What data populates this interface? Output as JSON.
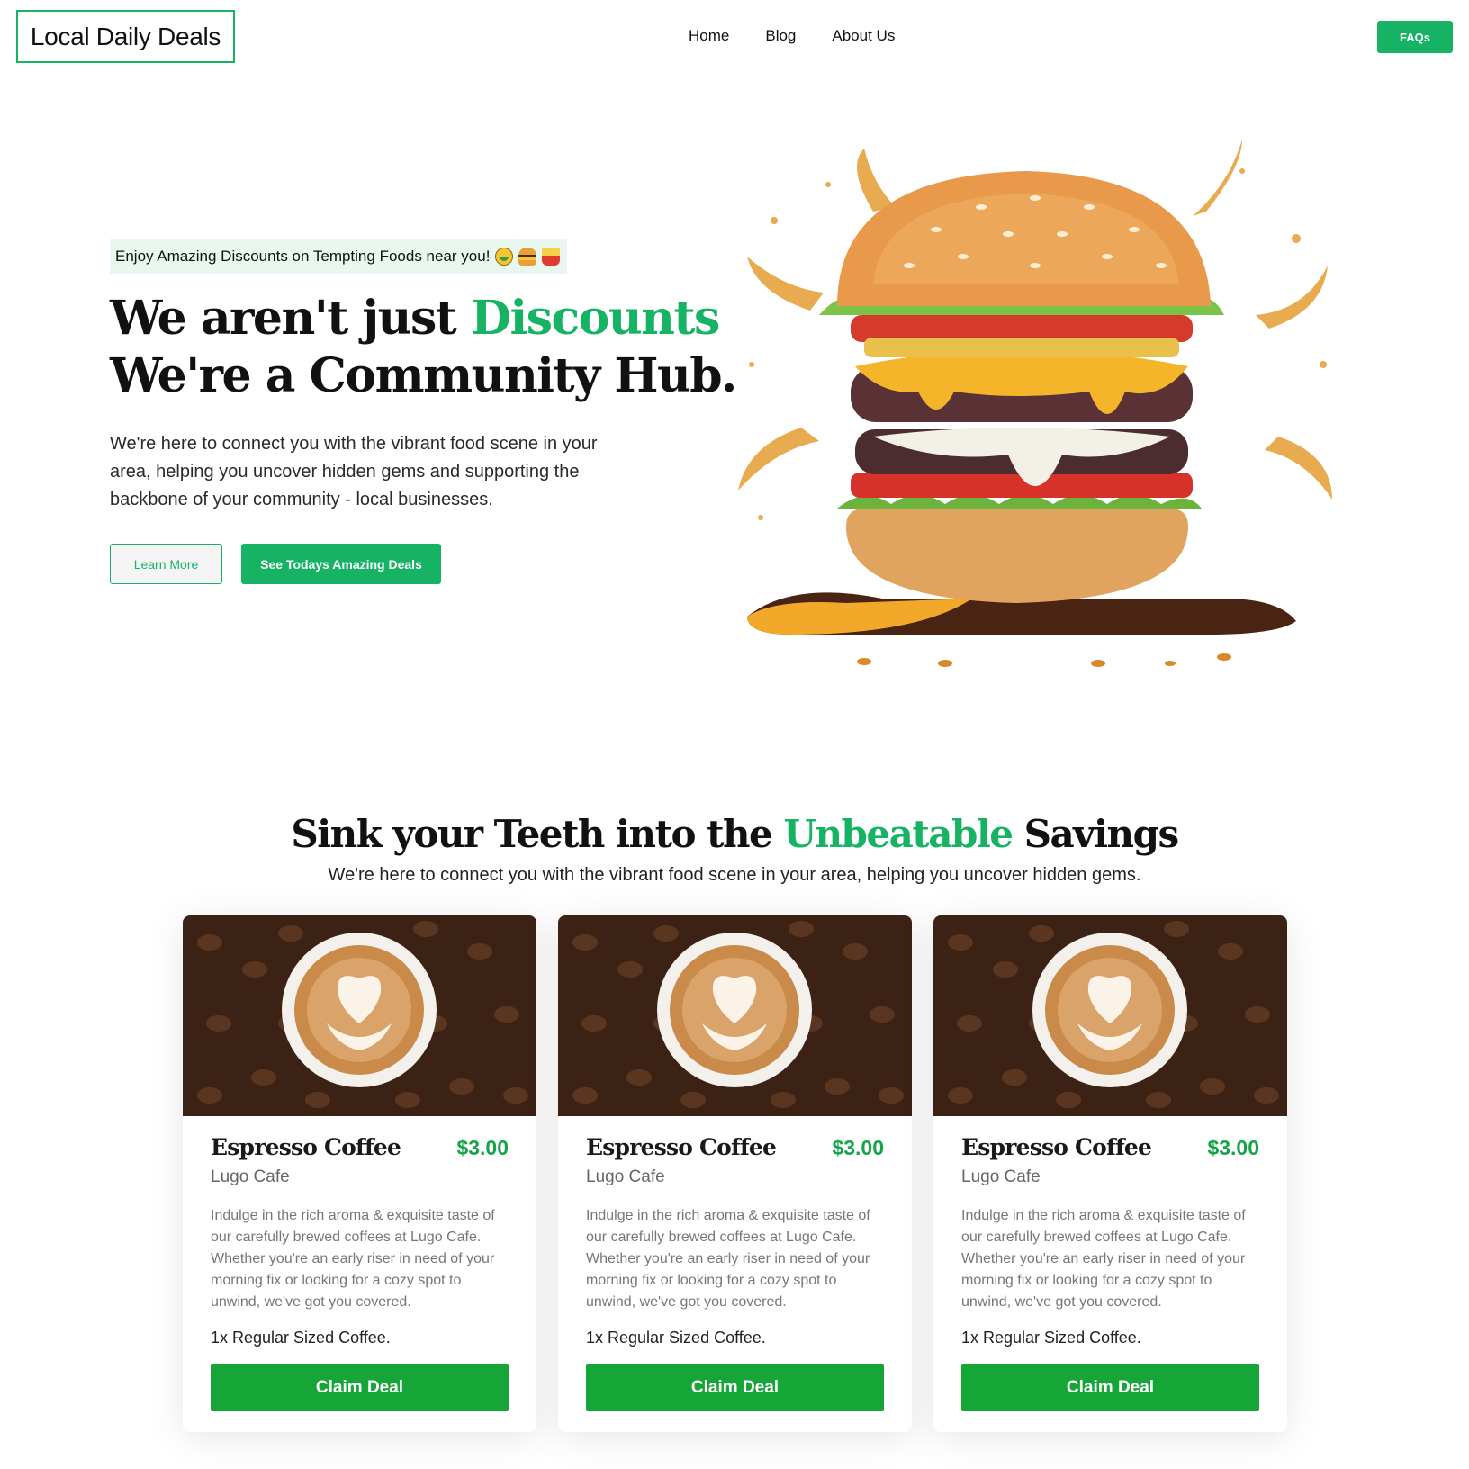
{
  "header": {
    "logo": "Local Daily Deals",
    "nav": [
      "Home",
      "Blog",
      "About Us"
    ],
    "cta": "FAQs"
  },
  "hero": {
    "tagline": "Enjoy Amazing Discounts on Tempting Foods near you!",
    "title_line1_pre": "We aren't just ",
    "title_line1_accent": "Discounts",
    "title_line2": "We're a Community Hub.",
    "body": "We're here to connect you with the vibrant food scene in your area, helping you uncover hidden gems and supporting the backbone of your community - local businesses.",
    "btn_learn": "Learn More",
    "btn_deals": "See Todays Amazing Deals"
  },
  "section": {
    "title_pre": "Sink your Teeth into the ",
    "title_accent": "Unbeatable",
    "title_post": " Savings",
    "subtitle": "We're here to connect you with the vibrant food scene in your area, helping you uncover hidden gems."
  },
  "deals": [
    {
      "title": "Espresso Coffee",
      "price": "$3.00",
      "vendor": "Lugo Cafe",
      "description": "Indulge in the rich aroma & exquisite taste of our carefully brewed coffees at Lugo Cafe. Whether you're an early riser in need of your morning fix or looking for a cozy spot to unwind, we've got you covered.",
      "item": "1x Regular Sized Coffee.",
      "button": "Claim Deal"
    },
    {
      "title": "Espresso Coffee",
      "price": "$3.00",
      "vendor": "Lugo Cafe",
      "description": "Indulge in the rich aroma & exquisite taste of our carefully brewed coffees at Lugo Cafe. Whether you're an early riser in need of your morning fix or looking for a cozy spot to unwind, we've got you covered.",
      "item": "1x Regular Sized Coffee.",
      "button": "Claim Deal"
    },
    {
      "title": "Espresso Coffee",
      "price": "$3.00",
      "vendor": "Lugo Cafe",
      "description": "Indulge in the rich aroma & exquisite taste of our carefully brewed coffees at Lugo Cafe. Whether you're an early riser in need of your morning fix or looking for a cozy spot to unwind, we've got you covered.",
      "item": "1x Regular Sized Coffee.",
      "button": "Claim Deal"
    }
  ],
  "colors": {
    "accent": "#16b364",
    "claim": "#16a637"
  },
  "icons": [
    "money-mouth-face-icon",
    "burger-icon",
    "fries-icon"
  ]
}
